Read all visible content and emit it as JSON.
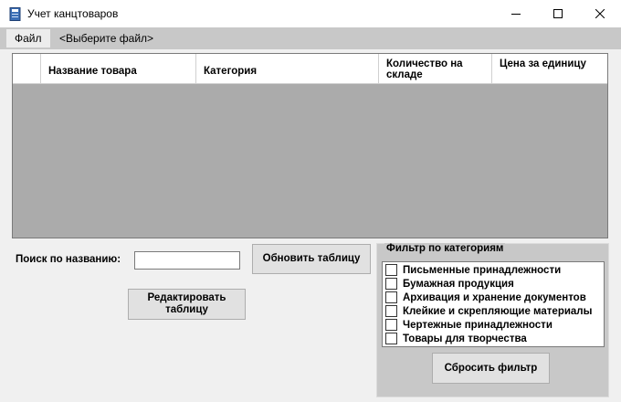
{
  "window": {
    "title": "Учет канцтоваров",
    "icon": "notebook-icon",
    "controls": [
      "minimize-icon",
      "maximize-icon",
      "close-icon"
    ]
  },
  "menu": {
    "file_label": "Файл",
    "selected_file": "<Выберите файл>"
  },
  "grid": {
    "columns": [
      "Название товара",
      "Категория",
      "Количество на складе",
      "Цена за единицу"
    ],
    "rows": []
  },
  "search": {
    "label": "Поиск по названию:",
    "value": ""
  },
  "buttons": {
    "refresh": "Обновить таблицу",
    "edit": "Редактировать таблицу",
    "reset_filter": "Сбросить фильтр"
  },
  "filter": {
    "title": "Фильтр по категориям",
    "categories": [
      {
        "label": "Письменные принадлежности",
        "checked": false
      },
      {
        "label": "Бумажная продукция",
        "checked": false
      },
      {
        "label": "Архивация и хранение документов",
        "checked": false
      },
      {
        "label": "Клейкие и скрепляющие материалы",
        "checked": false
      },
      {
        "label": "Чертежные принадлежности",
        "checked": false
      },
      {
        "label": "Товары для творчества",
        "checked": false
      }
    ]
  }
}
